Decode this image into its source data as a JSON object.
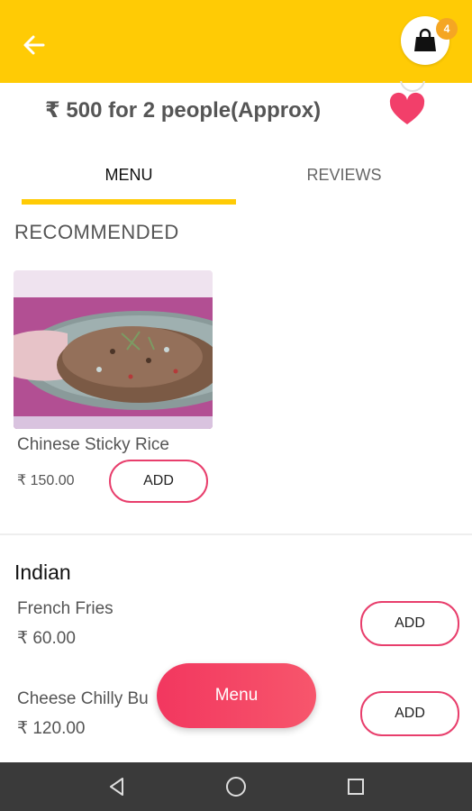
{
  "header": {
    "back_icon": "arrow-left-icon",
    "cart_icon": "shopping-bag-icon",
    "cart_count": "4",
    "accent_color": "#ffcb05"
  },
  "restaurant": {
    "price_info": "₹ 500 for 2 people(Approx)",
    "favorite_icon": "heart-icon",
    "favorite_color": "#f23f6a"
  },
  "tabs": [
    {
      "label": "MENU",
      "active": true
    },
    {
      "label": "REVIEWS",
      "active": false
    }
  ],
  "recommended": {
    "title": "RECOMMENDED",
    "items": [
      {
        "name": "Chinese Sticky Rice",
        "price": "₹ 150.00",
        "add_label": "ADD"
      }
    ]
  },
  "category": {
    "title": "Indian",
    "items": [
      {
        "name": "French Fries",
        "price": "₹ 60.00",
        "add_label": "ADD"
      },
      {
        "name": "Cheese Chilly Bu",
        "price": "₹ 120.00",
        "add_label": "ADD"
      }
    ]
  },
  "fab": {
    "label": "Menu"
  },
  "system_nav": [
    "back-triangle-icon",
    "home-circle-icon",
    "recents-square-icon"
  ]
}
